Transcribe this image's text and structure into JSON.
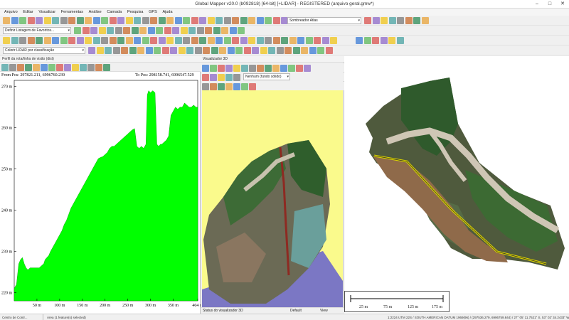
{
  "window": {
    "title": "Global Mapper v20.0 (b092818) [64-bit] [+LIDAR] - REGISTERED (arquivo geral.gmw*)",
    "min": "–",
    "max": "□",
    "close": "✕"
  },
  "menu": [
    "Arquivo",
    "Editar",
    "Visualizar",
    "Ferramentas",
    "Análise",
    "Camada",
    "Pesquisa",
    "GPS",
    "Ajuda"
  ],
  "toolbar": {
    "favorites_combo": "Definir Listagem de Favoritos...",
    "shader_combo": "Sombreador Atlas",
    "lidar_combo": "Colorir LIDAR por classificação"
  },
  "profile": {
    "title": "Perfil da rota/linha de visão (dist)",
    "from_pos": "From Pos: 297821.211, 6996760.239",
    "to_pos": "To Pos: 298158.741, 6996547.529",
    "bottom_tab": "Centro de Contr..."
  },
  "viewer3d": {
    "title": "Visualizador 3D",
    "background_combo": "Nenhum (fundo sólido)",
    "status_label": "Status do visualizador 3D",
    "status_default": "Default",
    "status_view": "View"
  },
  "scalebar": {
    "labels": [
      "25 m",
      "75 m",
      "125 m",
      "175 m"
    ]
  },
  "statusbar": {
    "selection": "Área (1 feature(s) selected)",
    "coords": "1:2224   UTM 22S / SOUTH AMERICAN DATUM 1969(96) / (297536.279, 6996759.844)  /  27° 05' 11.7521\" S, 53° 02' 34.2433\" W"
  },
  "chart_data": {
    "type": "area",
    "title": "",
    "xlabel": "",
    "ylabel": "",
    "x_ticks": [
      "50 m",
      "100 m",
      "150 m",
      "200 m",
      "250 m",
      "300 m",
      "350 m",
      "404 m"
    ],
    "y_ticks": [
      "220 m",
      "230 m",
      "240 m",
      "250 m",
      "260 m",
      "270 m"
    ],
    "xlim": [
      0,
      404
    ],
    "ylim": [
      218,
      271.5
    ],
    "series": [
      {
        "color": "#00ff00",
        "x": [
          0,
          5,
          10,
          14,
          18,
          22,
          26,
          30,
          35,
          42,
          48,
          55,
          60,
          65,
          68,
          72,
          76,
          80,
          85,
          90,
          95,
          100,
          105,
          110,
          115,
          120,
          125,
          130,
          135,
          140,
          145,
          150,
          155,
          160,
          165,
          170,
          175,
          180,
          185,
          190,
          195,
          200,
          205,
          210,
          215,
          220,
          225,
          230,
          235,
          240,
          245,
          250,
          255,
          260,
          265,
          270,
          275,
          280,
          285,
          290,
          293,
          296,
          300,
          305,
          310,
          314,
          318,
          322,
          325,
          330,
          335,
          340,
          345,
          350,
          355,
          360,
          365,
          370,
          375,
          380,
          385,
          390,
          395,
          400,
          404
        ],
        "y": [
          221,
          222,
          227,
          228,
          228.5,
          227,
          226,
          225.5,
          226,
          226,
          226,
          226,
          226.5,
          227,
          228,
          228.5,
          229,
          230,
          231,
          232,
          233,
          234,
          235,
          236.5,
          237.5,
          239,
          240.5,
          241.5,
          242.5,
          243.5,
          244.5,
          245.5,
          246.5,
          247.5,
          248.5,
          249.5,
          250.5,
          251.5,
          252.5,
          252.8,
          253,
          253.5,
          254,
          255,
          255.5,
          255.5,
          256,
          256.5,
          257,
          257.5,
          258,
          258.5,
          259,
          259.5,
          259.8,
          255.5,
          255,
          255.5,
          255,
          256,
          268,
          269,
          268.5,
          269,
          268.5,
          256,
          255.5,
          256,
          256,
          256.5,
          257,
          258,
          263,
          264,
          265,
          264.5,
          265,
          265,
          266,
          265.5,
          265,
          265,
          265.5,
          265,
          265
        ]
      }
    ]
  }
}
